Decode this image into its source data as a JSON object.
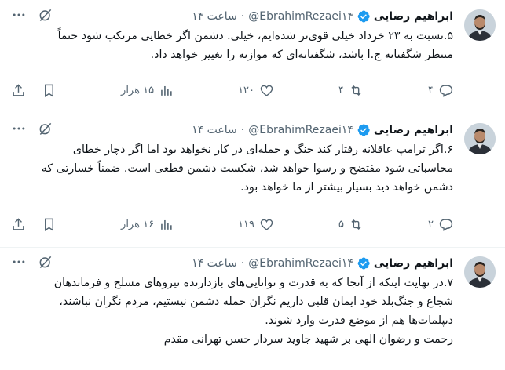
{
  "tweets": [
    {
      "name": "ابراهیم رضایی",
      "handle": "@EbrahimRezaei۱۴",
      "time": "ساعت ۱۴",
      "dot": "·",
      "text": [
        "۵.نسبت به ۲۳ خرداد خیلی قوی‌تر شده‌ایم، خیلی. دشمن اگر خطایی مرتکب شود حتماً",
        "منتظر شگفتانه ج.ا باشد، شگفتانه‌ای که موازنه را تغییر خواهد داد."
      ],
      "replies": "۴",
      "reposts": "۴",
      "likes": "۱۲۰",
      "views": "۱۵ هزار"
    },
    {
      "name": "ابراهیم رضایی",
      "handle": "@EbrahimRezaei۱۴",
      "time": "ساعت ۱۴",
      "dot": "·",
      "text": [
        "۶.اگر ترامپ عاقلانه رفتار کند جنگ و حمله‌ای در کار نخواهد بود اما اگر دچار خطای",
        "محاسباتی شود مفتضح و رسوا خواهد شد، شکست دشمن قطعی است. ضمناً خسارتی که",
        "دشمن خواهد دید بسیار بیشتر از ما خواهد بود."
      ],
      "replies": "۲",
      "reposts": "۵",
      "likes": "۱۱۹",
      "views": "۱۶ هزار"
    },
    {
      "name": "ابراهیم رضایی",
      "handle": "@EbrahimRezaei۱۴",
      "time": "ساعت ۱۴",
      "dot": "·",
      "text": [
        "۷.در نهایت اینکه از آنجا که به قدرت و توانایی‌های بازدارنده نیروهای مسلح و فرماندهان",
        "شجاع و جنگ‌بلد خود ایمان قلبی داریم نگران حمله دشمن نیستیم، مردم نگران نباشند،",
        "دیپلمات‌ها هم از موضع قدرت وارد شوند.",
        "رحمت و رضوان الهی بر شهید جاوید سردار حسن تهرانی مقدم"
      ]
    }
  ],
  "icons": [
    "avatar",
    "verified-badge-icon",
    "grok-icon",
    "more-icon",
    "reply-icon",
    "repost-icon",
    "like-icon",
    "views-icon",
    "bookmark-icon",
    "share-icon"
  ],
  "colors": {
    "verified": "#1d9bf0",
    "secondary_text": "#536471",
    "divider": "#eff3f4"
  }
}
